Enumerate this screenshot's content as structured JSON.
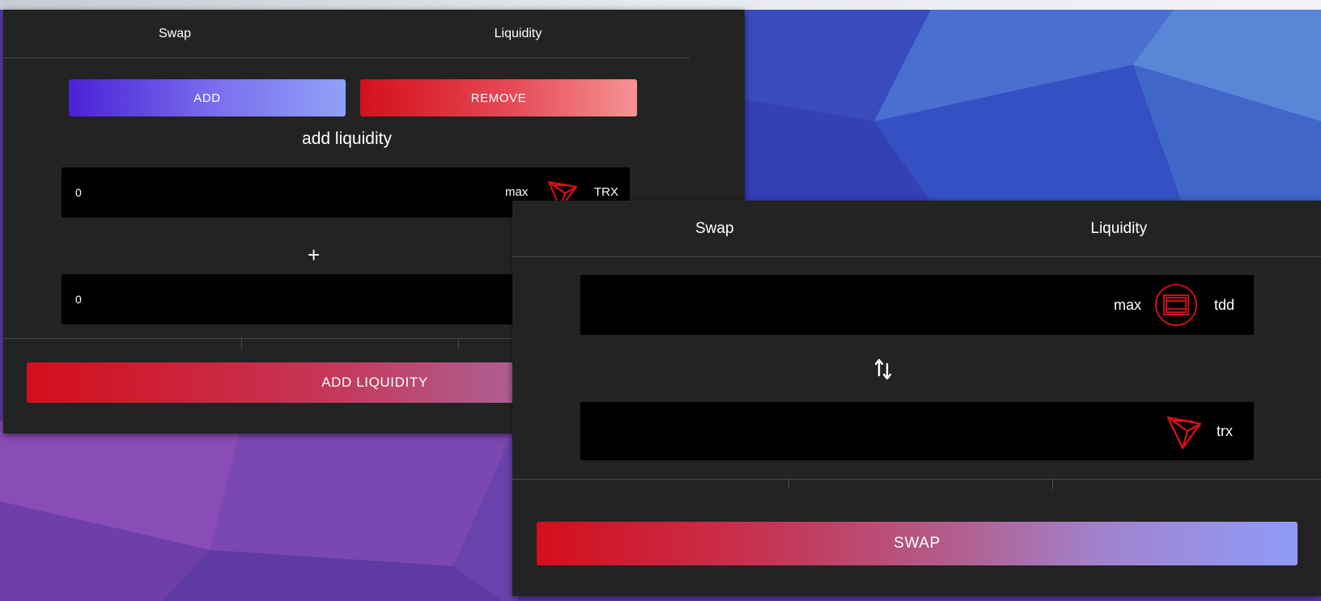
{
  "liquidity_panel": {
    "tabs": [
      "Swap",
      "Liquidity"
    ],
    "add_button": "ADD",
    "remove_button": "REMOVE",
    "title": "add liquidity",
    "field_a": {
      "value": "0",
      "max_label": "max",
      "token": "TRX",
      "token_icon": "tron-icon"
    },
    "plus_label": "+",
    "field_b": {
      "value": "0"
    },
    "action_button": "ADD LIQUIDITY"
  },
  "swap_panel": {
    "tabs": [
      "Swap",
      "Liquidity"
    ],
    "from_field": {
      "value": "",
      "max_label": "max",
      "token": "tdd",
      "token_icon": "tdd-token-icon"
    },
    "switch_icon": "swap-arrows-icon",
    "to_field": {
      "value": "",
      "token": "trx",
      "token_icon": "tron-icon"
    },
    "action_button": "SWAP"
  },
  "colors": {
    "panel_bg": "#232323",
    "field_bg": "#000000",
    "accent_red": "#d40e1c",
    "accent_blue": "#8f9bf7",
    "accent_purple": "#4a21d9"
  }
}
